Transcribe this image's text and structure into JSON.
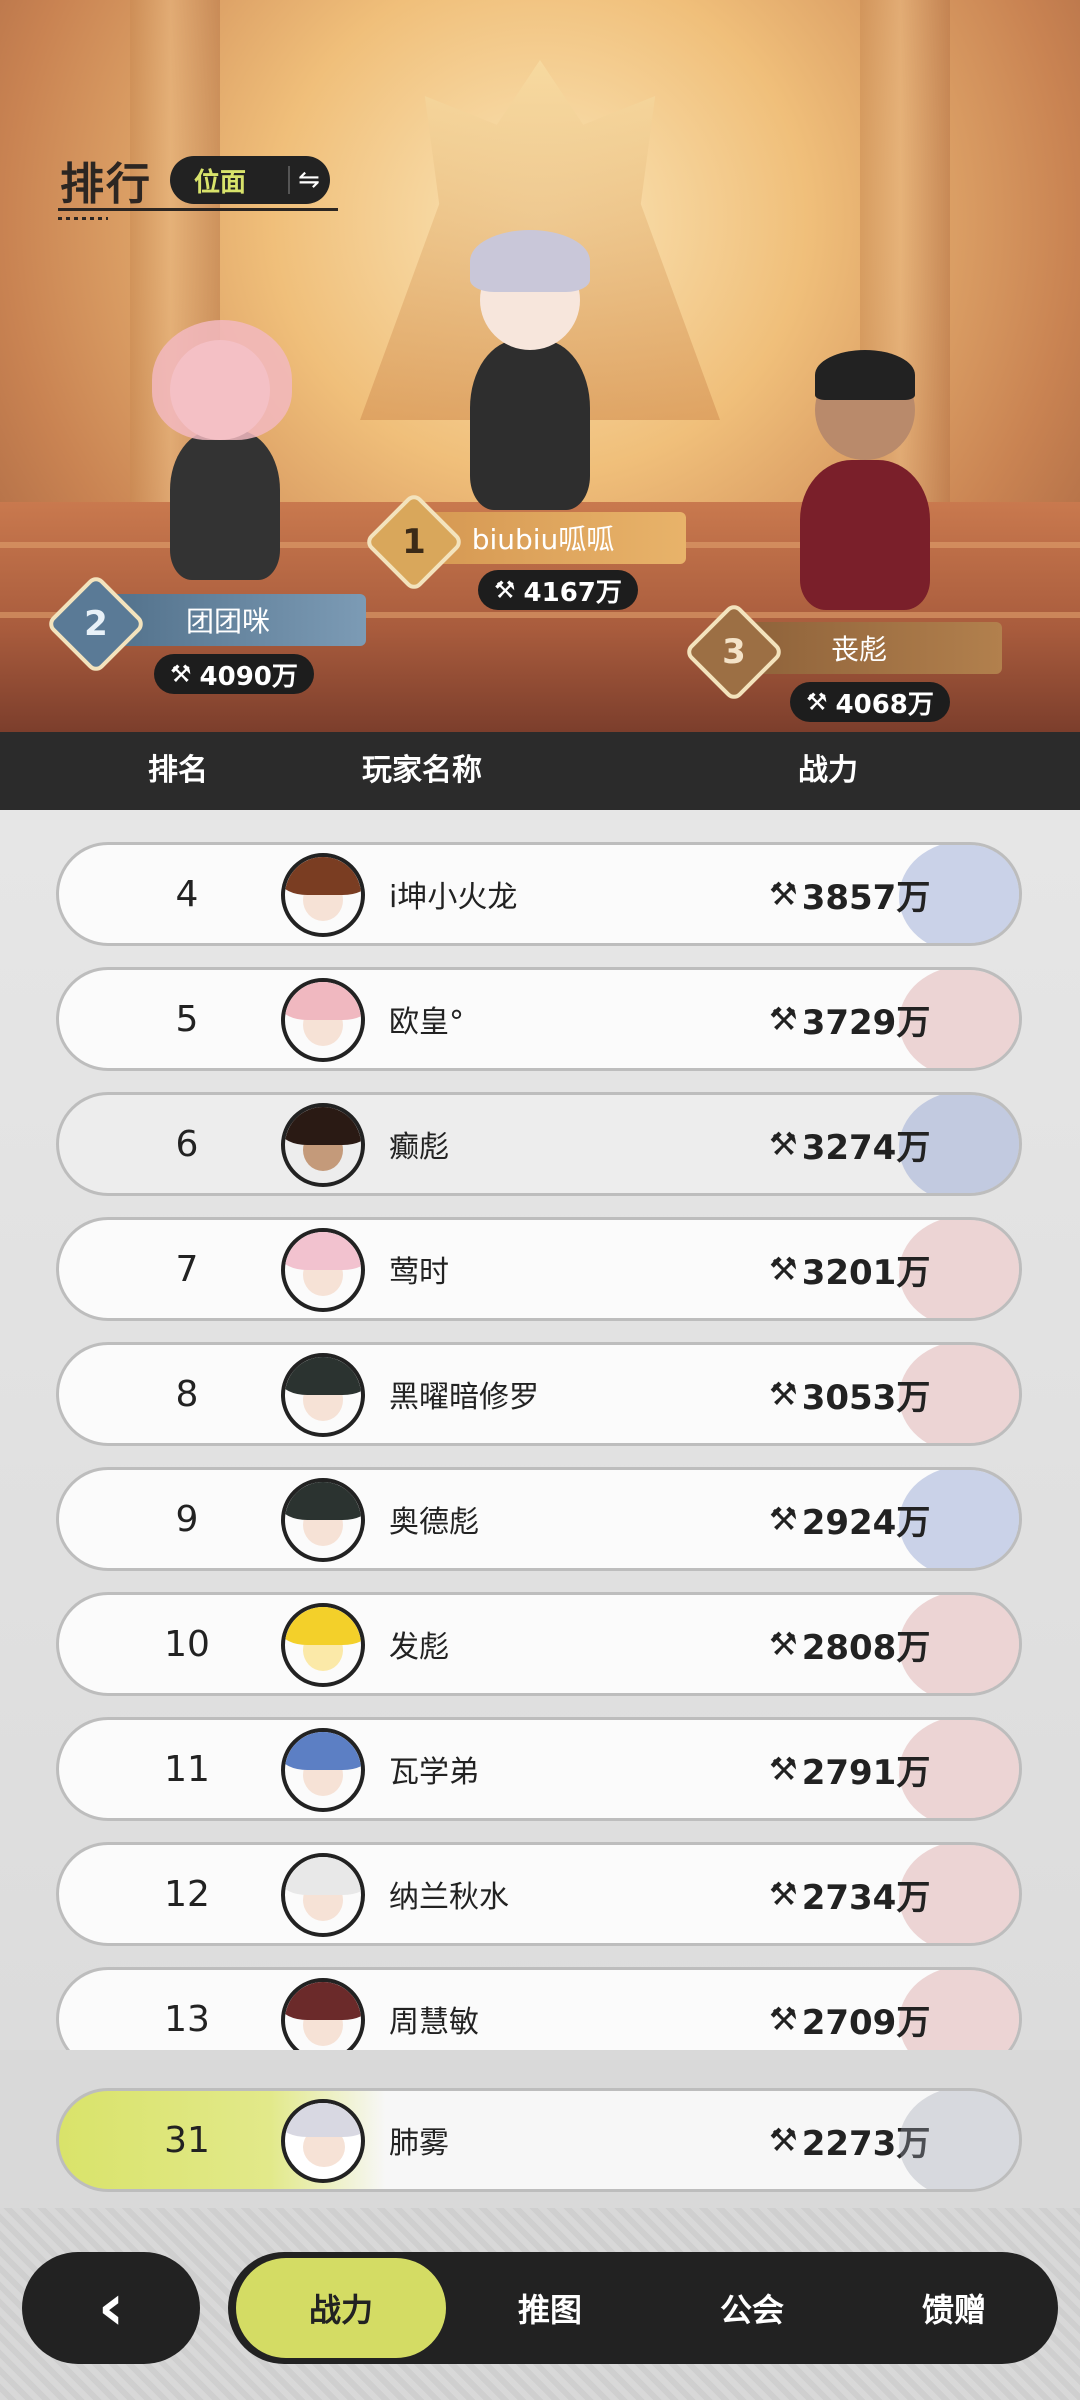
{
  "header": {
    "title": "排行",
    "plane_label": "位面",
    "swap_icon": "⇋"
  },
  "podium": {
    "first": {
      "rank": "1",
      "name": "biubiu呱呱",
      "power": "4167万"
    },
    "second": {
      "rank": "2",
      "name": "团团咪",
      "power": "4090万"
    },
    "third": {
      "rank": "3",
      "name": "丧彪",
      "power": "4068万"
    }
  },
  "columns": {
    "rank": "排名",
    "player": "玩家名称",
    "power": "战力"
  },
  "power_icon": "⚒",
  "rows": [
    {
      "rank": "4",
      "name": "i坤小火龙",
      "power": "3857万"
    },
    {
      "rank": "5",
      "name": "欧皇°",
      "power": "3729万"
    },
    {
      "rank": "6",
      "name": "癫彪",
      "power": "3274万"
    },
    {
      "rank": "7",
      "name": "莺时",
      "power": "3201万"
    },
    {
      "rank": "8",
      "name": "黑曜暗修罗",
      "power": "3053万"
    },
    {
      "rank": "9",
      "name": "奥德彪",
      "power": "2924万"
    },
    {
      "rank": "10",
      "name": "发彪",
      "power": "2808万"
    },
    {
      "rank": "11",
      "name": "瓦学弟",
      "power": "2791万"
    },
    {
      "rank": "12",
      "name": "纳兰秋水",
      "power": "2734万"
    },
    {
      "rank": "13",
      "name": "周慧敏",
      "power": "2709万"
    }
  ],
  "my_rank": {
    "rank": "31",
    "name": "肺雾",
    "power": "2273万"
  },
  "nav": {
    "back_icon": "‹",
    "tabs": [
      "战力",
      "推图",
      "公会",
      "馈赠"
    ],
    "active": "战力"
  },
  "colors": {
    "accent": "#d4dc64",
    "dark": "#222222"
  }
}
